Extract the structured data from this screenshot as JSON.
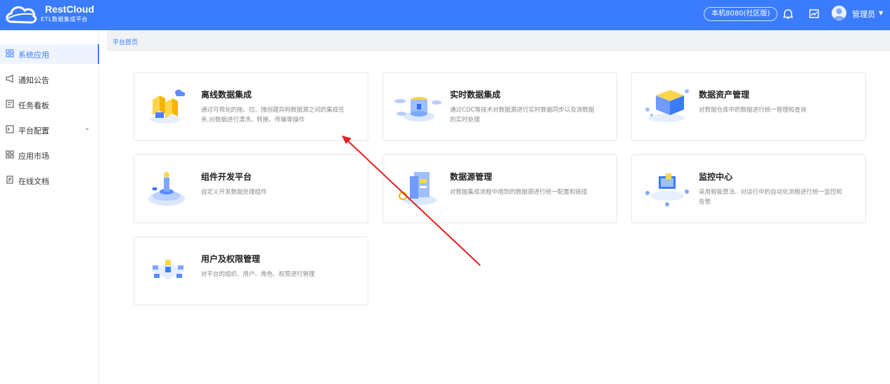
{
  "header": {
    "logo_title": "RestCloud",
    "logo_subtitle": "ETL数据集成平台",
    "env_badge": "本机8080(社区版)",
    "user_name": "管理员"
  },
  "sidebar": {
    "items": [
      {
        "label": "系统应用",
        "icon": "grid-icon",
        "active": true
      },
      {
        "label": "通知公告",
        "icon": "megaphone-icon"
      },
      {
        "label": "任务看板",
        "icon": "dashboard-icon"
      },
      {
        "label": "平台配置",
        "icon": "config-icon",
        "has_submenu": true
      },
      {
        "label": "应用市场",
        "icon": "apps-icon"
      },
      {
        "label": "在线文档",
        "icon": "document-icon"
      }
    ]
  },
  "breadcrumb": "平台首页",
  "cards": [
    {
      "title": "离线数据集成",
      "desc": "通过可视化的拖、拉、拽创建异构数据源之间的集成任务,对数据进行清洗、转换、传输等操作",
      "icon": "offline-integration-icon"
    },
    {
      "title": "实时数据集成",
      "desc": "通过CDC等技术对数据源进行实时数据同步以及流数据的实时处理",
      "icon": "realtime-integration-icon"
    },
    {
      "title": "数据资产管理",
      "desc": "对数据仓库中的数据进行统一管理和查询",
      "icon": "data-asset-icon"
    },
    {
      "title": "组件开发平台",
      "desc": "自定义开发数据处理组件",
      "icon": "component-dev-icon"
    },
    {
      "title": "数据源管理",
      "desc": "对数据集成流程中用到的数据源进行统一配置和链接",
      "icon": "datasource-icon"
    },
    {
      "title": "监控中心",
      "desc": "采用智能算法、对运行中的自动化流程进行统一监控和告警",
      "icon": "monitor-icon"
    },
    {
      "title": "用户及权限管理",
      "desc": "对平台的组织、用户、角色、权限进行管理",
      "icon": "user-permission-icon"
    }
  ],
  "colors": {
    "accent": "#3b7cff",
    "annotation_arrow": "#e02020"
  }
}
